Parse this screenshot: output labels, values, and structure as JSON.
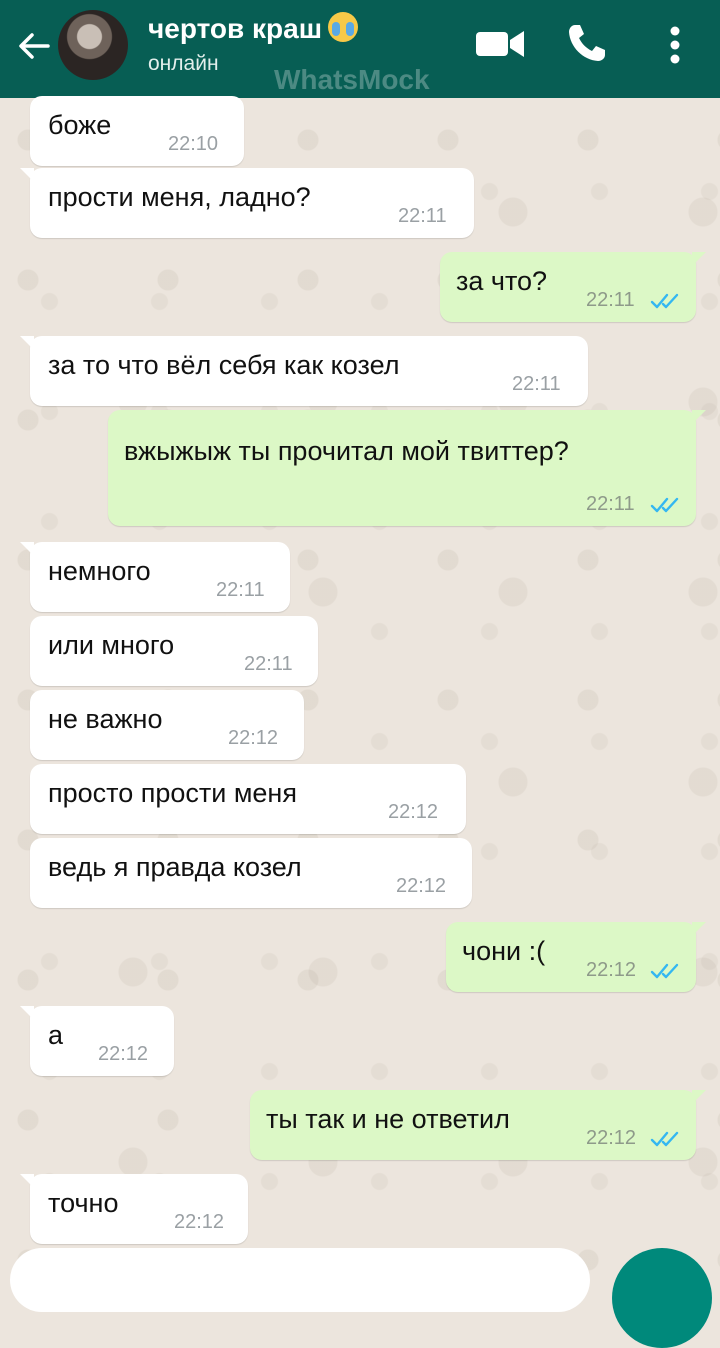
{
  "header": {
    "contact_name": "чертов краш",
    "status": "онлайн",
    "watermark": "WhatsMock",
    "icons": [
      "back-arrow-icon",
      "avatar",
      "crying-emoji-icon",
      "video-call-icon",
      "phone-call-icon",
      "more-vert-icon"
    ]
  },
  "colors": {
    "header_bg": "#075e54",
    "chat_bg": "#ece5dd",
    "incoming_bubble": "#ffffff",
    "outgoing_bubble": "#dcf8c6",
    "read_ticks": "#34b7f1",
    "fab": "#00897b"
  },
  "messages": [
    {
      "dir": "in",
      "text": "боже",
      "time": "22:10"
    },
    {
      "dir": "in",
      "text": "прости меня, ладно?",
      "time": "22:11"
    },
    {
      "dir": "out",
      "text": "за что?",
      "time": "22:11",
      "read": true
    },
    {
      "dir": "in",
      "text": "за то что вёл себя как козел",
      "time": "22:11"
    },
    {
      "dir": "out",
      "text": "вжыжыж ты прочитал мой твиттер?",
      "time": "22:11",
      "read": true
    },
    {
      "dir": "in",
      "text": "немного",
      "time": "22:11"
    },
    {
      "dir": "in",
      "text": "или много",
      "time": "22:11"
    },
    {
      "dir": "in",
      "text": "не важно",
      "time": "22:12"
    },
    {
      "dir": "in",
      "text": "просто прости меня",
      "time": "22:12"
    },
    {
      "dir": "in",
      "text": "ведь я правда козел",
      "time": "22:12"
    },
    {
      "dir": "out",
      "text": "чони :(",
      "time": "22:12",
      "read": true
    },
    {
      "dir": "in",
      "text": "а",
      "time": "22:12"
    },
    {
      "dir": "out",
      "text": "ты так и не ответил",
      "time": "22:12",
      "read": true
    },
    {
      "dir": "in",
      "text": "точно",
      "time": "22:12"
    }
  ]
}
